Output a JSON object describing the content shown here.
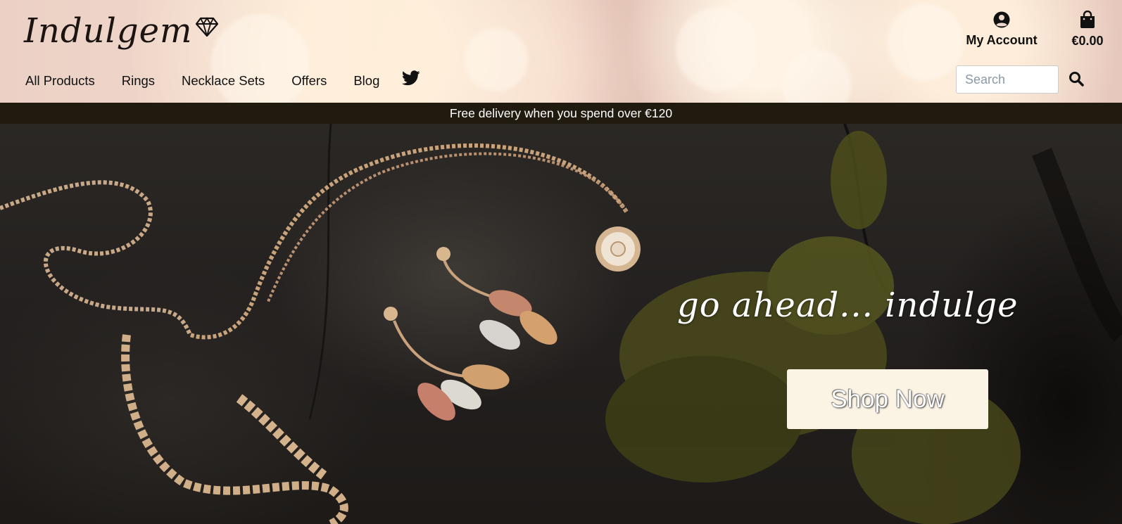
{
  "brand": {
    "name": "Indulgem",
    "logo_icon": "diamond-icon"
  },
  "header": {
    "account_label": "My Account",
    "account_icon": "user-circle-icon",
    "cart_total": "€0.00",
    "cart_icon": "shopping-bag-icon"
  },
  "nav": {
    "items": [
      {
        "label": "All Products"
      },
      {
        "label": "Rings"
      },
      {
        "label": "Necklace Sets"
      },
      {
        "label": "Offers"
      },
      {
        "label": "Blog"
      }
    ],
    "social_icon": "twitter-icon"
  },
  "search": {
    "placeholder": "Search",
    "icon": "search-icon"
  },
  "banner": {
    "text": "Free delivery when you spend over €120"
  },
  "hero": {
    "tagline": "go ahead... indulge",
    "cta_label": "Shop Now"
  },
  "colors": {
    "banner_bg": "#211a0f",
    "cta_bg": "#fbf3e4",
    "header_tint": "#ecd0c5"
  }
}
